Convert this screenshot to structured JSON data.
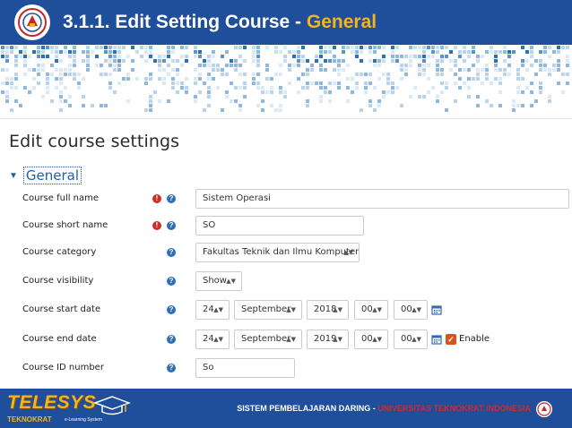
{
  "slide": {
    "title_prefix": "3.1.1. Edit Setting Course - ",
    "title_accent": "General",
    "accent_color": "#f5b41a",
    "header_color": "#1f4e9b"
  },
  "form": {
    "heading": "Edit course settings",
    "section": "General",
    "fields": {
      "full_name": {
        "label": "Course full name",
        "value": "Sistem Operasi"
      },
      "short_name": {
        "label": "Course short name",
        "value": "SO"
      },
      "category": {
        "label": "Course category",
        "value": "Fakultas Teknik dan Ilmu Komputer"
      },
      "visibility": {
        "label": "Course visibility",
        "value": "Show"
      },
      "start_date": {
        "label": "Course start date",
        "day": "24",
        "month": "September",
        "year": "2018",
        "hour": "00",
        "minute": "00"
      },
      "end_date": {
        "label": "Course end date",
        "day": "24",
        "month": "September",
        "year": "2019",
        "hour": "00",
        "minute": "00",
        "enable_label": "Enable",
        "enabled": true
      },
      "id_number": {
        "label": "Course ID number",
        "value": "So"
      }
    }
  },
  "footer": {
    "brand": "TELESYS",
    "brand_sub": "TEKNOKRAT",
    "brand_tag": "e-Learning System",
    "text_white": "SISTEM PEMBELAJARAN DARING - ",
    "text_red": "UNIVERSITAS TEKNOKRAT INDONESIA"
  },
  "icons": {
    "required": "exclamation-circle-icon",
    "help": "question-circle-icon",
    "calendar": "calendar-icon",
    "collapse": "caret-down-icon"
  }
}
